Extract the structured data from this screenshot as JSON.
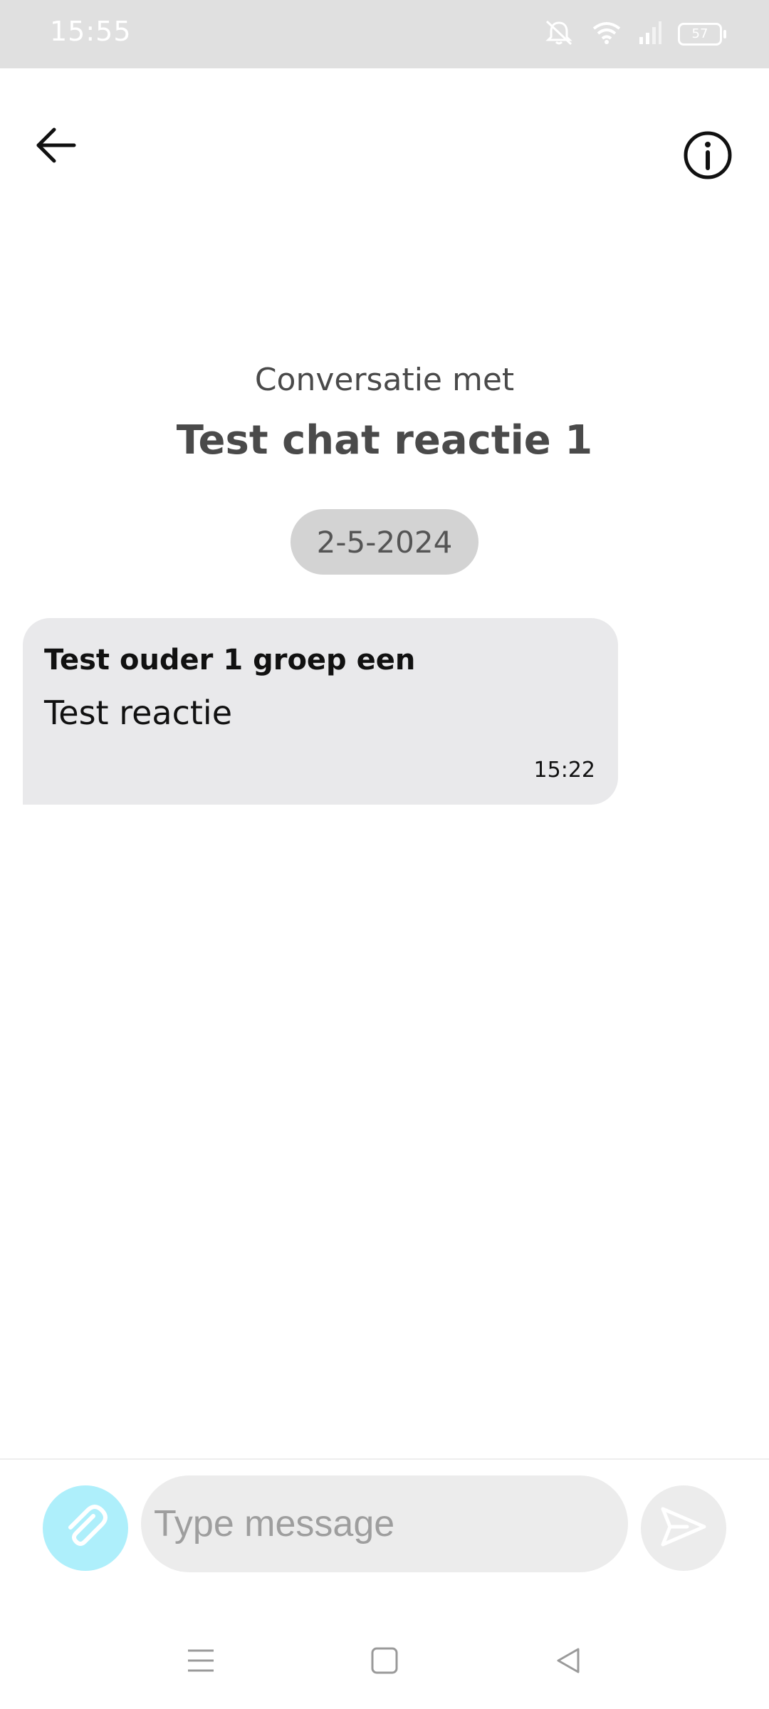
{
  "status_bar": {
    "time": "15:55",
    "battery_level": "57",
    "icons": [
      "mute-vibrate-icon",
      "wifi-icon",
      "signal-icon",
      "battery-icon"
    ]
  },
  "header": {
    "back_icon": "arrow-left-icon",
    "info_icon": "info-circle-icon",
    "conversation_label": "Conversatie met",
    "conversation_title": "Test chat reactie 1"
  },
  "date_separator": "2-5-2024",
  "messages": [
    {
      "sender": "Test ouder 1 groep een",
      "text": "Test reactie",
      "time": "15:22"
    }
  ],
  "composer": {
    "placeholder": "Type message",
    "value": "",
    "attach_icon": "paperclip-icon",
    "send_icon": "send-icon"
  },
  "nav_bar": {
    "icons": [
      "menu-icon",
      "home-icon",
      "back-triangle-icon"
    ]
  },
  "colors": {
    "status_bar": "#e0e0e0",
    "bubble": "#e9e9eb",
    "date_pill": "#d3d3d3",
    "attach_button": "#aeeffb",
    "input": "#ececec"
  }
}
